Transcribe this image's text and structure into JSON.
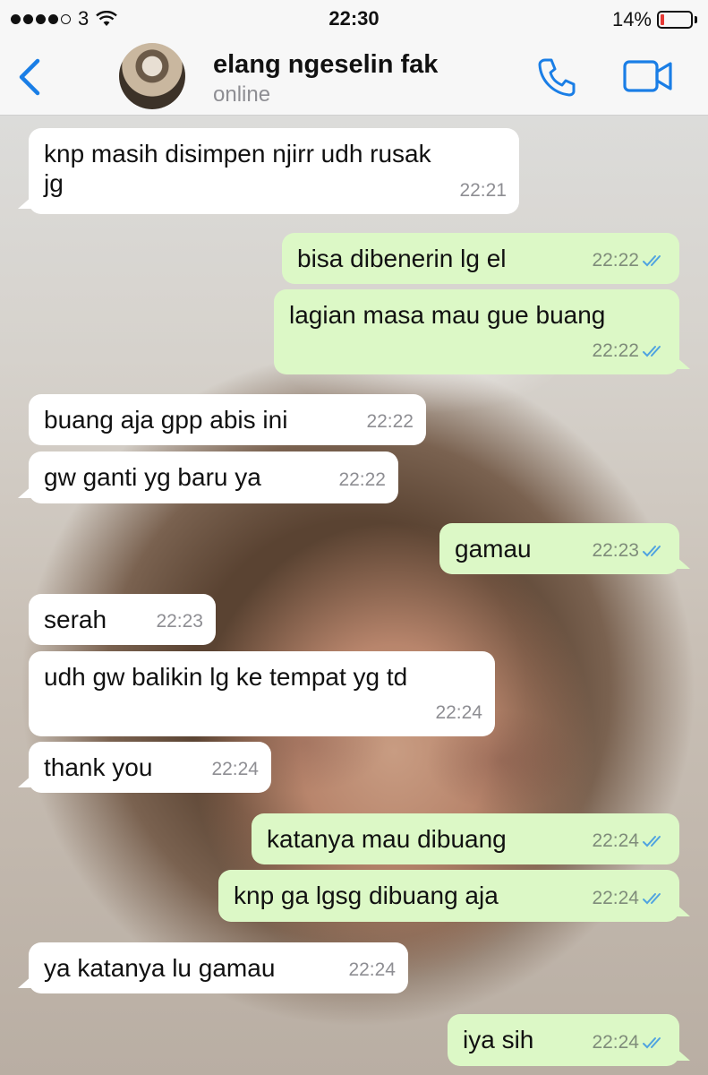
{
  "status_bar": {
    "carrier": "3",
    "time": "22:30",
    "battery": "14%",
    "battery_level": 0.14,
    "signal_icon": "signal-dots-icon",
    "wifi_icon": "wifi-icon"
  },
  "header": {
    "back_icon": "chevron-left-icon",
    "contact_name": "elang ngeselin fak",
    "contact_status": "online",
    "call_icon": "phone-icon",
    "video_icon": "video-camera-icon",
    "accent_color": "#1a7ee6"
  },
  "messages": [
    {
      "dir": "in",
      "text": [
        "knp masih disimpen njirr udh rusak",
        "jg"
      ],
      "time": "22:21"
    },
    {
      "dir": "out",
      "text": [
        "bisa dibenerin lg el"
      ],
      "time": "22:22",
      "read": true
    },
    {
      "dir": "out",
      "text": [
        "lagian masa mau gue buang"
      ],
      "time": "22:22",
      "read": true
    },
    {
      "dir": "in",
      "text": [
        "buang aja gpp abis ini"
      ],
      "time": "22:22"
    },
    {
      "dir": "in",
      "text": [
        "gw ganti yg baru ya"
      ],
      "time": "22:22"
    },
    {
      "dir": "out",
      "text": [
        "gamau"
      ],
      "time": "22:23",
      "read": true
    },
    {
      "dir": "in",
      "text": [
        "serah"
      ],
      "time": "22:23"
    },
    {
      "dir": "in",
      "text": [
        "udh gw balikin lg ke tempat yg td"
      ],
      "time": "22:24"
    },
    {
      "dir": "in",
      "text": [
        "thank you"
      ],
      "time": "22:24"
    },
    {
      "dir": "out",
      "text": [
        "katanya mau dibuang"
      ],
      "time": "22:24",
      "read": true
    },
    {
      "dir": "out",
      "text": [
        "knp ga lgsg dibuang aja"
      ],
      "time": "22:24",
      "read": true
    },
    {
      "dir": "in",
      "text": [
        "ya katanya lu gamau"
      ],
      "time": "22:24"
    },
    {
      "dir": "out",
      "text": [
        "iya sih"
      ],
      "time": "22:24",
      "read": true
    }
  ],
  "colors": {
    "incoming_bubble": "#ffffff",
    "outgoing_bubble": "#dcf8c6",
    "read_ticks": "#4fa3e0"
  }
}
